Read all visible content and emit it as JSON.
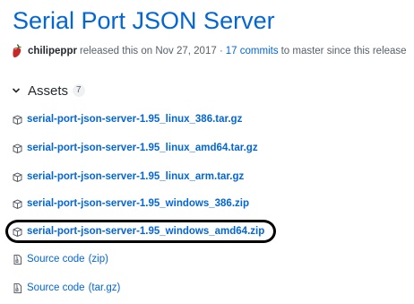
{
  "release": {
    "title": "Serial Port JSON Server",
    "author": "chilipeppr",
    "released_text": "released this on Nov 27, 2017 ·",
    "commits_link": "17 commits",
    "commits_suffix": "to master since this release"
  },
  "assets": {
    "label": "Assets",
    "count": "7",
    "items": [
      {
        "name": "serial-port-json-server-1.95_linux_386.tar.gz",
        "icon": "package-icon"
      },
      {
        "name": "serial-port-json-server-1.95_linux_amd64.tar.gz",
        "icon": "package-icon"
      },
      {
        "name": "serial-port-json-server-1.95_linux_arm.tar.gz",
        "icon": "package-icon"
      },
      {
        "name": "serial-port-json-server-1.95_windows_386.zip",
        "icon": "package-icon"
      },
      {
        "name": "serial-port-json-server-1.95_windows_amd64.zip",
        "icon": "package-icon",
        "highlighted": true
      }
    ],
    "source_items": [
      {
        "label": "Source code",
        "format": "(zip)",
        "icon": "file-zip-icon"
      },
      {
        "label": "Source code",
        "format": "(tar.gz)",
        "icon": "file-zip-icon"
      }
    ]
  },
  "colors": {
    "link": "#0366d6",
    "text": "#24292e",
    "muted": "#586069",
    "highlight": "#000000"
  }
}
